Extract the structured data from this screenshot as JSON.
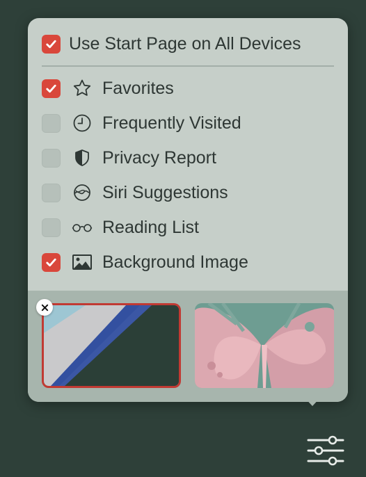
{
  "popover": {
    "master_option": {
      "label": "Use Start Page on All Devices",
      "checked": true
    },
    "sections": [
      {
        "label": "Favorites",
        "checked": true,
        "icon": "star-icon"
      },
      {
        "label": "Frequently Visited",
        "checked": false,
        "icon": "clock-icon"
      },
      {
        "label": "Privacy Report",
        "checked": false,
        "icon": "shield-icon"
      },
      {
        "label": "Siri Suggestions",
        "checked": false,
        "icon": "siri-icon"
      },
      {
        "label": "Reading List",
        "checked": false,
        "icon": "glasses-icon"
      },
      {
        "label": "Background Image",
        "checked": true,
        "icon": "image-icon"
      }
    ],
    "backgrounds": [
      {
        "name": "blue-stripes",
        "selected": true
      },
      {
        "name": "butterfly",
        "selected": false
      }
    ]
  },
  "colors": {
    "page_bg": "#2e4039",
    "popover_bg": "#c6cfc9",
    "footer_bg": "#a7b5ad",
    "checkbox_on": "#d9473b",
    "selected_border": "#c13a33"
  },
  "toolbar": {
    "settings_icon": "sliders-icon"
  }
}
